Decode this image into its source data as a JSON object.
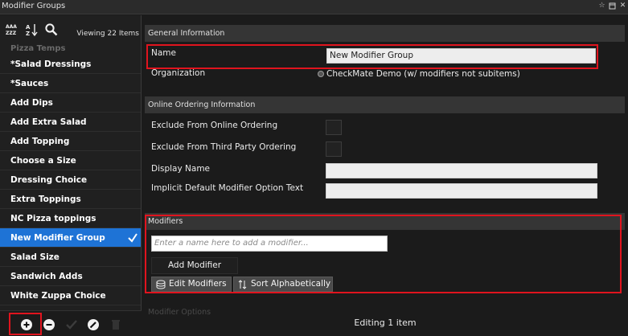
{
  "window": {
    "title": "Modifier Groups"
  },
  "toolbar": {
    "viewing": "Viewing 22 Items"
  },
  "list": {
    "ghost_item": "Pizza Temps",
    "items": [
      {
        "label": "*Salad Dressings"
      },
      {
        "label": "*Sauces"
      },
      {
        "label": "Add Dips"
      },
      {
        "label": "Add Extra Salad"
      },
      {
        "label": "Add Topping"
      },
      {
        "label": "Choose a Size"
      },
      {
        "label": "Dressing Choice"
      },
      {
        "label": "Extra Toppings"
      },
      {
        "label": "NC Pizza toppings"
      },
      {
        "label": "New Modifier Group",
        "selected": true
      },
      {
        "label": "Salad Size"
      },
      {
        "label": "Sandwich Adds"
      },
      {
        "label": "White Zuppa Choice"
      }
    ]
  },
  "general": {
    "header": "General Information",
    "name_label": "Name",
    "name_value": "New Modifier Group",
    "org_label": "Organization",
    "org_value": "CheckMate Demo (w/ modifiers not subitems)"
  },
  "online": {
    "header": "Online Ordering Information",
    "exclude_online_label": "Exclude From Online Ordering",
    "exclude_third_party_label": "Exclude From Third Party Ordering",
    "display_name_label": "Display Name",
    "implicit_default_label": "Implicit Default Modifier Option Text"
  },
  "modifiers": {
    "header": "Modifiers",
    "input_placeholder": "Enter a name here to add a modifier...",
    "add_button": "Add Modifier",
    "edit_button": "Edit Modifiers",
    "sort_button": "Sort Alphabetically"
  },
  "next_section": "Modifier Options",
  "status": {
    "text": "Editing 1 item"
  },
  "colors": {
    "accent": "#1e73d6",
    "highlight": "#e0141e",
    "section": "#353535"
  }
}
